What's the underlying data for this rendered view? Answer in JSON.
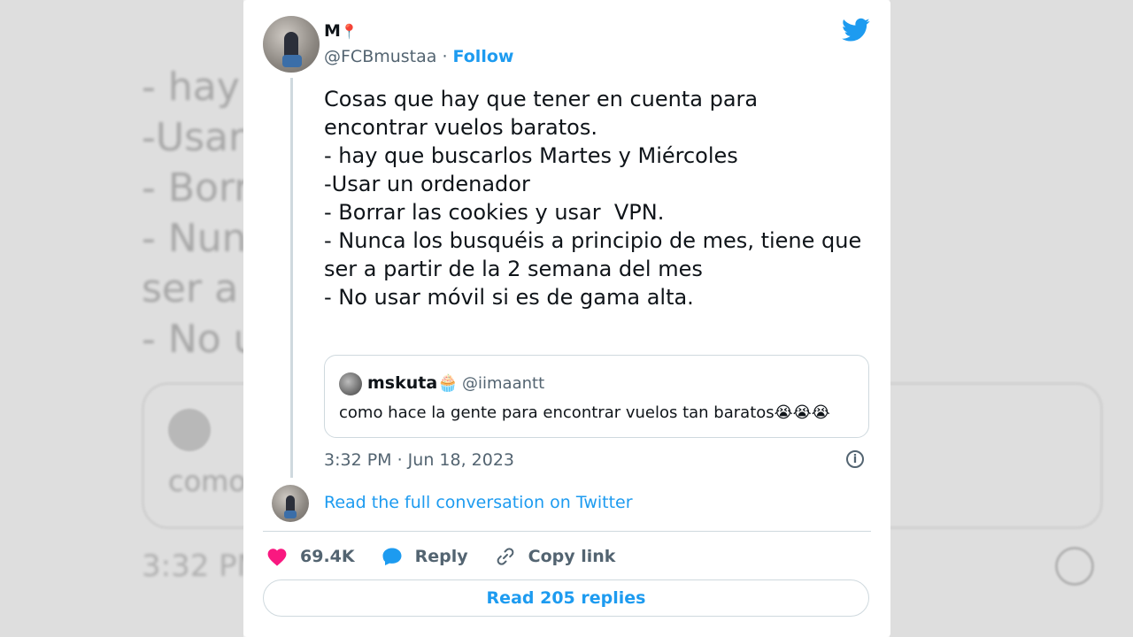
{
  "background": {
    "text": "- hay\n-Usar\n- Borr\n- Nun                                                          s, tiene que\nser a\n- No u",
    "quote": "como                                                                      tos😭😭😭",
    "time": "3:32 PM"
  },
  "tweet": {
    "display_name": "M",
    "name_emoji": "📍",
    "handle": "@FCBmustaa",
    "separator": " · ",
    "follow_label": "Follow",
    "text_lines": [
      "Cosas que hay que tener en cuenta para",
      "encontrar vuelos baratos.",
      "",
      "- hay que buscarlos Martes y Miércoles",
      "-Usar un ordenador",
      "- Borrar las cookies y usar  VPN.",
      "- Nunca los busquéis a principio de mes, tiene que",
      "ser a partir de la 2 semana del mes",
      "- No usar móvil si es de gama alta."
    ],
    "quote": {
      "name": "mskuta🧁",
      "handle": "@iimaantt",
      "text": "como hace la gente para encontrar vuelos tan baratos😭😭😭"
    },
    "timestamp": "3:32 PM · Jun 18, 2023",
    "full_conversation_label": "Read the full conversation on Twitter",
    "actions": {
      "likes": "69.4K",
      "reply_label": "Reply",
      "copy_link_label": "Copy link"
    },
    "read_replies_label": "Read 205 replies"
  },
  "colors": {
    "accent": "#1d9bf0",
    "like": "#f91880",
    "text": "#0f1419",
    "muted": "#536471"
  }
}
